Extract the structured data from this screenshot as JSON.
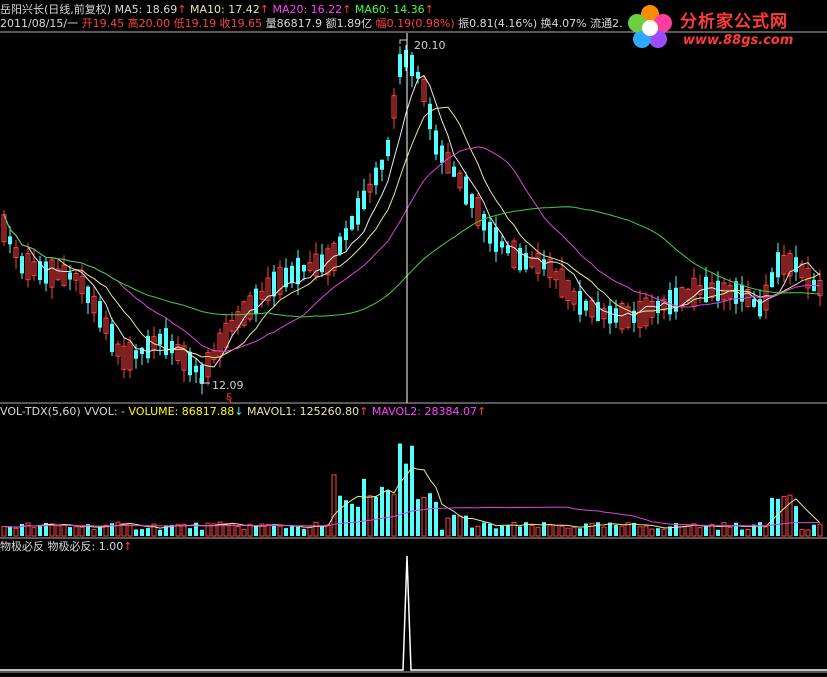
{
  "header": {
    "stock": "岳阳兴长(日线,前复权)",
    "ma5": "MA5: 18.69",
    "ma10": "MA10: 17.42",
    "ma20": "MA20: 16.22",
    "ma60": "MA60: 14.36",
    "date": "2011/08/15/一",
    "open": "开19.45",
    "high": "高20.00",
    "low": "低19.19",
    "close": "收19.65",
    "volume": "量86817.9",
    "amount": "额1.89亿",
    "change": "幅0.19(0.98%)",
    "amplitude": "振0.81(4.16%)",
    "turnover": "换4.07%",
    "float": "流通2."
  },
  "volume_header": {
    "name": "VOL-TDX(5,60)",
    "vvol": "VVOL: -",
    "volume": "VOLUME: 86817.88",
    "mavol1": "MAVOL1: 125260.80",
    "mavol2": "MAVOL2: 28384.07"
  },
  "indicator_header": {
    "name": "物极必反",
    "value": "物极必反: 1.00"
  },
  "annotations": {
    "high": "20.10",
    "low": "12.09"
  },
  "logo": {
    "text1": "分析家公式网",
    "text2": "www.88gs.com"
  },
  "colors": {
    "up": "#ff4040",
    "down": "#54ffff",
    "ma5": "#e8e8e8",
    "ma10": "#e8e890",
    "ma20": "#e040e0",
    "ma60": "#40d040",
    "mavol1": "#e8e890",
    "mavol2": "#e040e0",
    "indicator": "#ffffff"
  },
  "chart_data": [
    {
      "type": "candlestick",
      "title": "岳阳兴长(日线,前复权)",
      "ylim": [
        11.5,
        20.6
      ],
      "series": [
        {
          "name": "MA5",
          "values": [
            18.69
          ]
        },
        {
          "name": "MA10",
          "values": [
            17.42
          ]
        },
        {
          "name": "MA20",
          "values": [
            16.22
          ]
        },
        {
          "name": "MA60",
          "values": [
            14.36
          ]
        }
      ],
      "marked_high": 20.1,
      "marked_low": 12.09,
      "selected": {
        "date": "2011/08/15",
        "open": 19.45,
        "high": 20.0,
        "low": 19.19,
        "close": 19.65
      }
    },
    {
      "type": "bar",
      "title": "VOL-TDX(5,60)",
      "series": [
        {
          "name": "VOLUME",
          "values": [
            86817.88
          ]
        },
        {
          "name": "MAVOL1",
          "values": [
            125260.8
          ]
        },
        {
          "name": "MAVOL2",
          "values": [
            28384.07
          ]
        }
      ]
    },
    {
      "type": "line",
      "title": "物极必反",
      "series": [
        {
          "name": "物极必反",
          "values": [
            1.0
          ]
        }
      ]
    }
  ]
}
